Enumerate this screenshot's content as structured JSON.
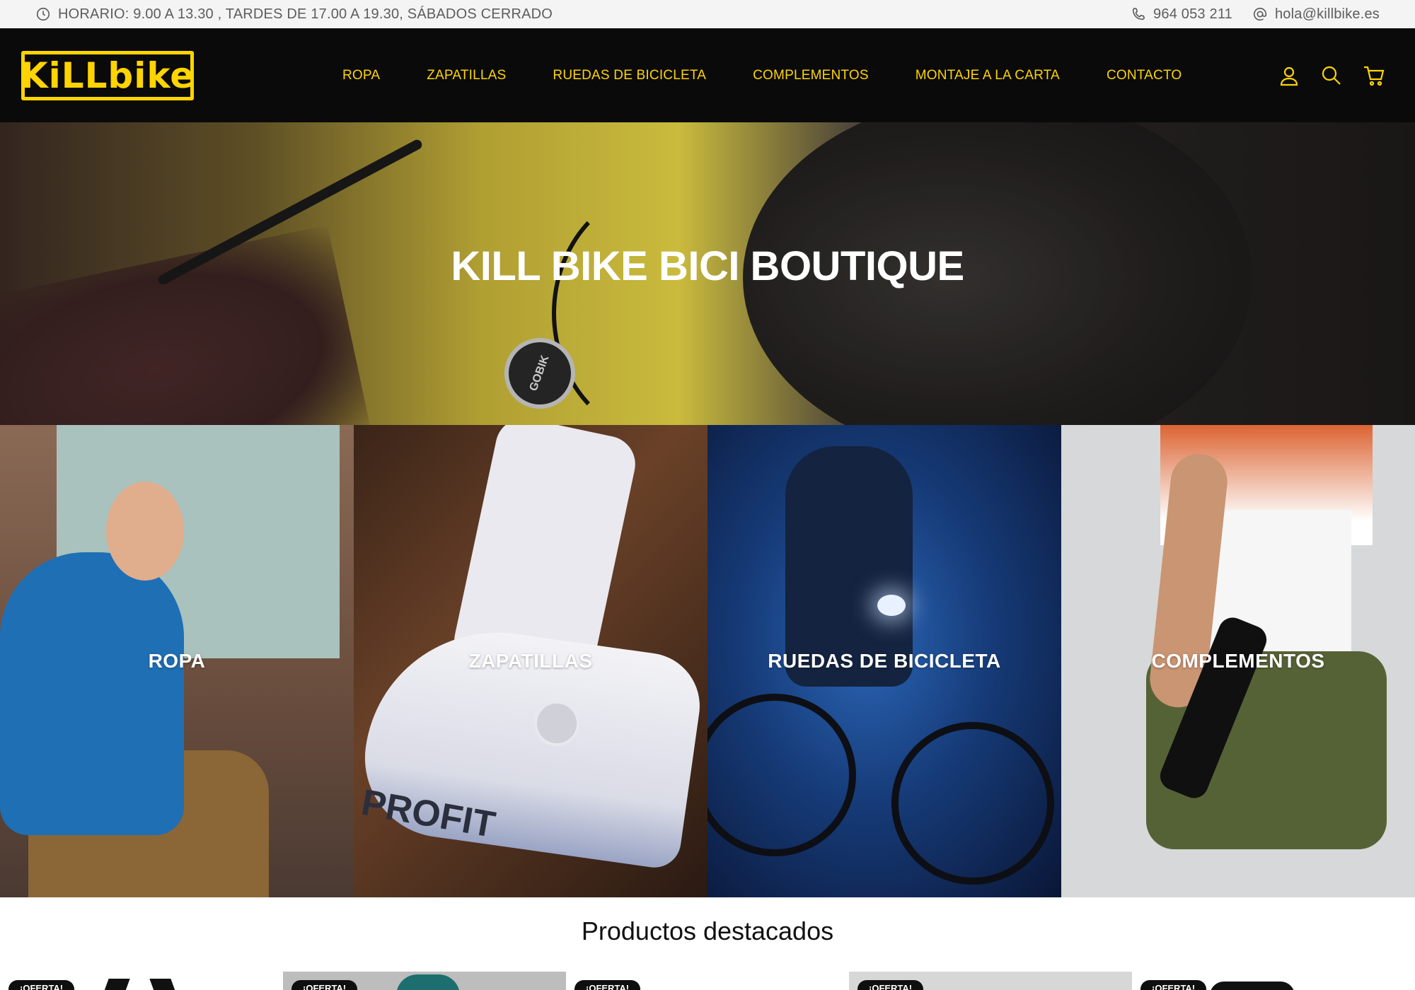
{
  "topbar": {
    "schedule": "HORARIO: 9.00 A 13.30 , TARDES DE 17.00 A 19.30, SÁBADOS CERRADO",
    "phone": "964 053 211",
    "email": "hola@killbike.es"
  },
  "header": {
    "logo_text": "KiLLbike",
    "nav": [
      "ROPA",
      "ZAPATILLAS",
      "RUEDAS DE BICICLETA",
      "COMPLEMENTOS",
      "MONTAJE A LA CARTA",
      "CONTACTO"
    ],
    "icons": [
      "user-icon",
      "search-icon",
      "cart-icon"
    ]
  },
  "hero": {
    "title": "KILL BIKE BICI BOUTIQUE",
    "emblem_text": "GOBIK"
  },
  "categories": [
    {
      "label": "ROPA"
    },
    {
      "label": "ZAPATILLAS",
      "brand": "PROFIT"
    },
    {
      "label": "RUEDAS DE BICICLETA"
    },
    {
      "label": "COMPLEMENTOS"
    }
  ],
  "featured": {
    "title": "Productos destacados",
    "products": [
      {
        "badge": "¡OFERTA!"
      },
      {
        "badge": "¡OFERTA!"
      },
      {
        "badge": "¡OFERTA!"
      },
      {
        "badge": "¡OFERTA!"
      },
      {
        "badge": "¡OFERTA!"
      }
    ]
  },
  "colors": {
    "accent": "#ffd400",
    "header_bg": "#0a0a0a",
    "topbar_bg": "#f4f4f4"
  }
}
